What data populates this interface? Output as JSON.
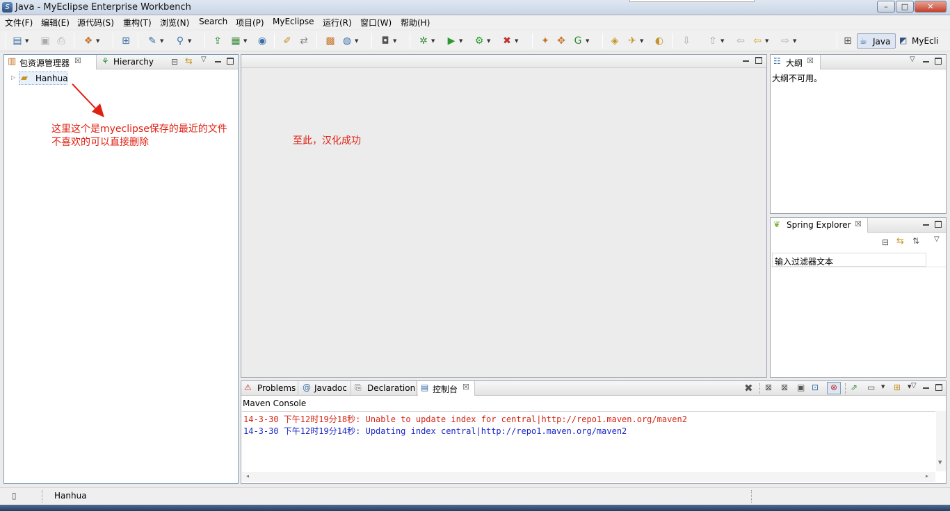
{
  "window": {
    "title": "Java  -  MyEclipse Enterprise Workbench",
    "min": "–",
    "max": "□",
    "close": "✕"
  },
  "menubar": [
    "文件(F)",
    "编辑(E)",
    "源代码(S)",
    "重构(T)",
    "浏览(N)",
    "Search",
    "项目(P)",
    "MyEclipse",
    "运行(R)",
    "窗口(W)",
    "帮助(H)"
  ],
  "perspectives": {
    "java": "Java",
    "myeclipse": "MyEcli"
  },
  "package_explorer": {
    "tab_label": "包资源管理器",
    "tab2_label": "Hierarchy",
    "tree_items": [
      "Hanhua"
    ]
  },
  "annotations": {
    "line1": "这里这个是myeclipse保存的最近的文件",
    "line2": "不喜欢的可以直接删除",
    "editor_note": "至此，汉化成功"
  },
  "outline": {
    "tab_label": "大纲",
    "message": "大纲不可用。"
  },
  "spring_explorer": {
    "tab_label": "Spring Explorer",
    "filter_placeholder": "输入过滤器文本"
  },
  "bottom_panel": {
    "tabs": [
      "Problems",
      "Javadoc",
      "Declaration",
      "控制台"
    ],
    "console_title": "Maven Console",
    "lines": [
      {
        "text": "14-3-30 下午12时19分18秒: Unable to update index for central|http://repo1.maven.org/maven2",
        "color": "#d42414"
      },
      {
        "text": "14-3-30 下午12时19分14秒: Updating index central|http://repo1.maven.org/maven2",
        "color": "#1a26c8"
      }
    ]
  },
  "statusbar": {
    "selection": "Hanhua"
  },
  "colors": {
    "annotation_red": "#e02010",
    "console_error": "#d42414",
    "console_info": "#1a26c8"
  }
}
